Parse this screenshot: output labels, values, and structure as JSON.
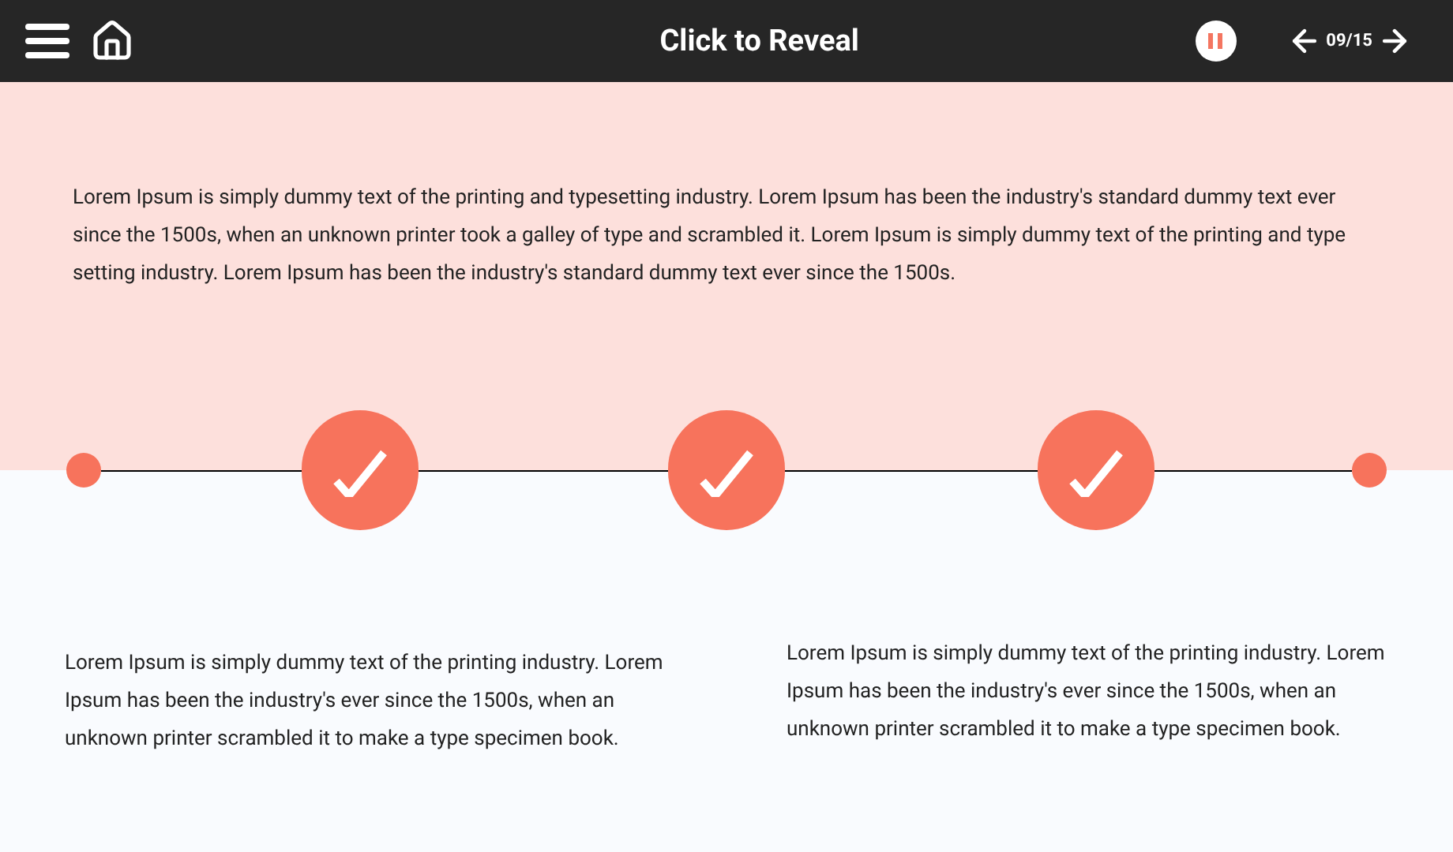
{
  "header": {
    "title": "Click to Reveal",
    "page_counter": "09/15"
  },
  "intro": "Lorem Ipsum is simply dummy text of the printing and typesetting industry. Lorem Ipsum has been the industry's standard dummy text ever since the 1500s, when an unknown printer took a galley of type and scrambled it. Lorem Ipsum is simply dummy text of the printing and type setting industry. Lorem Ipsum has been the industry's standard dummy text ever since the 1500s.",
  "steps": [
    {
      "checked": true
    },
    {
      "checked": true
    },
    {
      "checked": true
    }
  ],
  "panels": [
    "Lorem Ipsum is simply dummy text of the printing industry. Lorem Ipsum has been the industry's ever since the 1500s, when an unknown printer scrambled it to make a type specimen book.",
    "Lorem Ipsum is simply dummy text of the printing industry. Lorem Ipsum has been the industry's ever since the 1500s, when an unknown printer scrambled it to make a type specimen book."
  ]
}
